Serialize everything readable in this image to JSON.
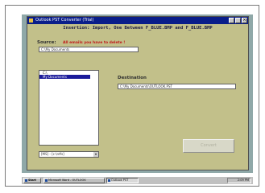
{
  "window": {
    "title": "Outlook PST Converter (Trial)",
    "close_glyph": "×"
  },
  "header": {
    "text": "Insertion: Import, One Between F_BLUE.BMP and F_BLUE.BMP"
  },
  "source": {
    "label": "Source:",
    "warning": "All emails you have to delete !",
    "path": "C:\\My Documents"
  },
  "tree": {
    "items": [
      {
        "label": "C:\\"
      },
      {
        "label": "My Documents",
        "selected": true
      }
    ]
  },
  "drive_select": {
    "value": "[MS] - [c:\\ntfs]",
    "arrow": "▾"
  },
  "destination": {
    "label": "Destination",
    "path": "C:\\My Documents\\OUTLOOK.PST"
  },
  "convert_button": {
    "label": "Convert"
  },
  "taskbar": {
    "start_label": "Start",
    "tasks": [
      {
        "label": "Microsoft Word - OUTLOOK"
      },
      {
        "label": "Outlook PST"
      }
    ],
    "clock": "2:09 PM"
  },
  "colors": {
    "window_bg": "#c2c08a",
    "titlebar": "#0a1e8a",
    "selection": "#1a1a9a",
    "warning_text": "#c01818"
  }
}
